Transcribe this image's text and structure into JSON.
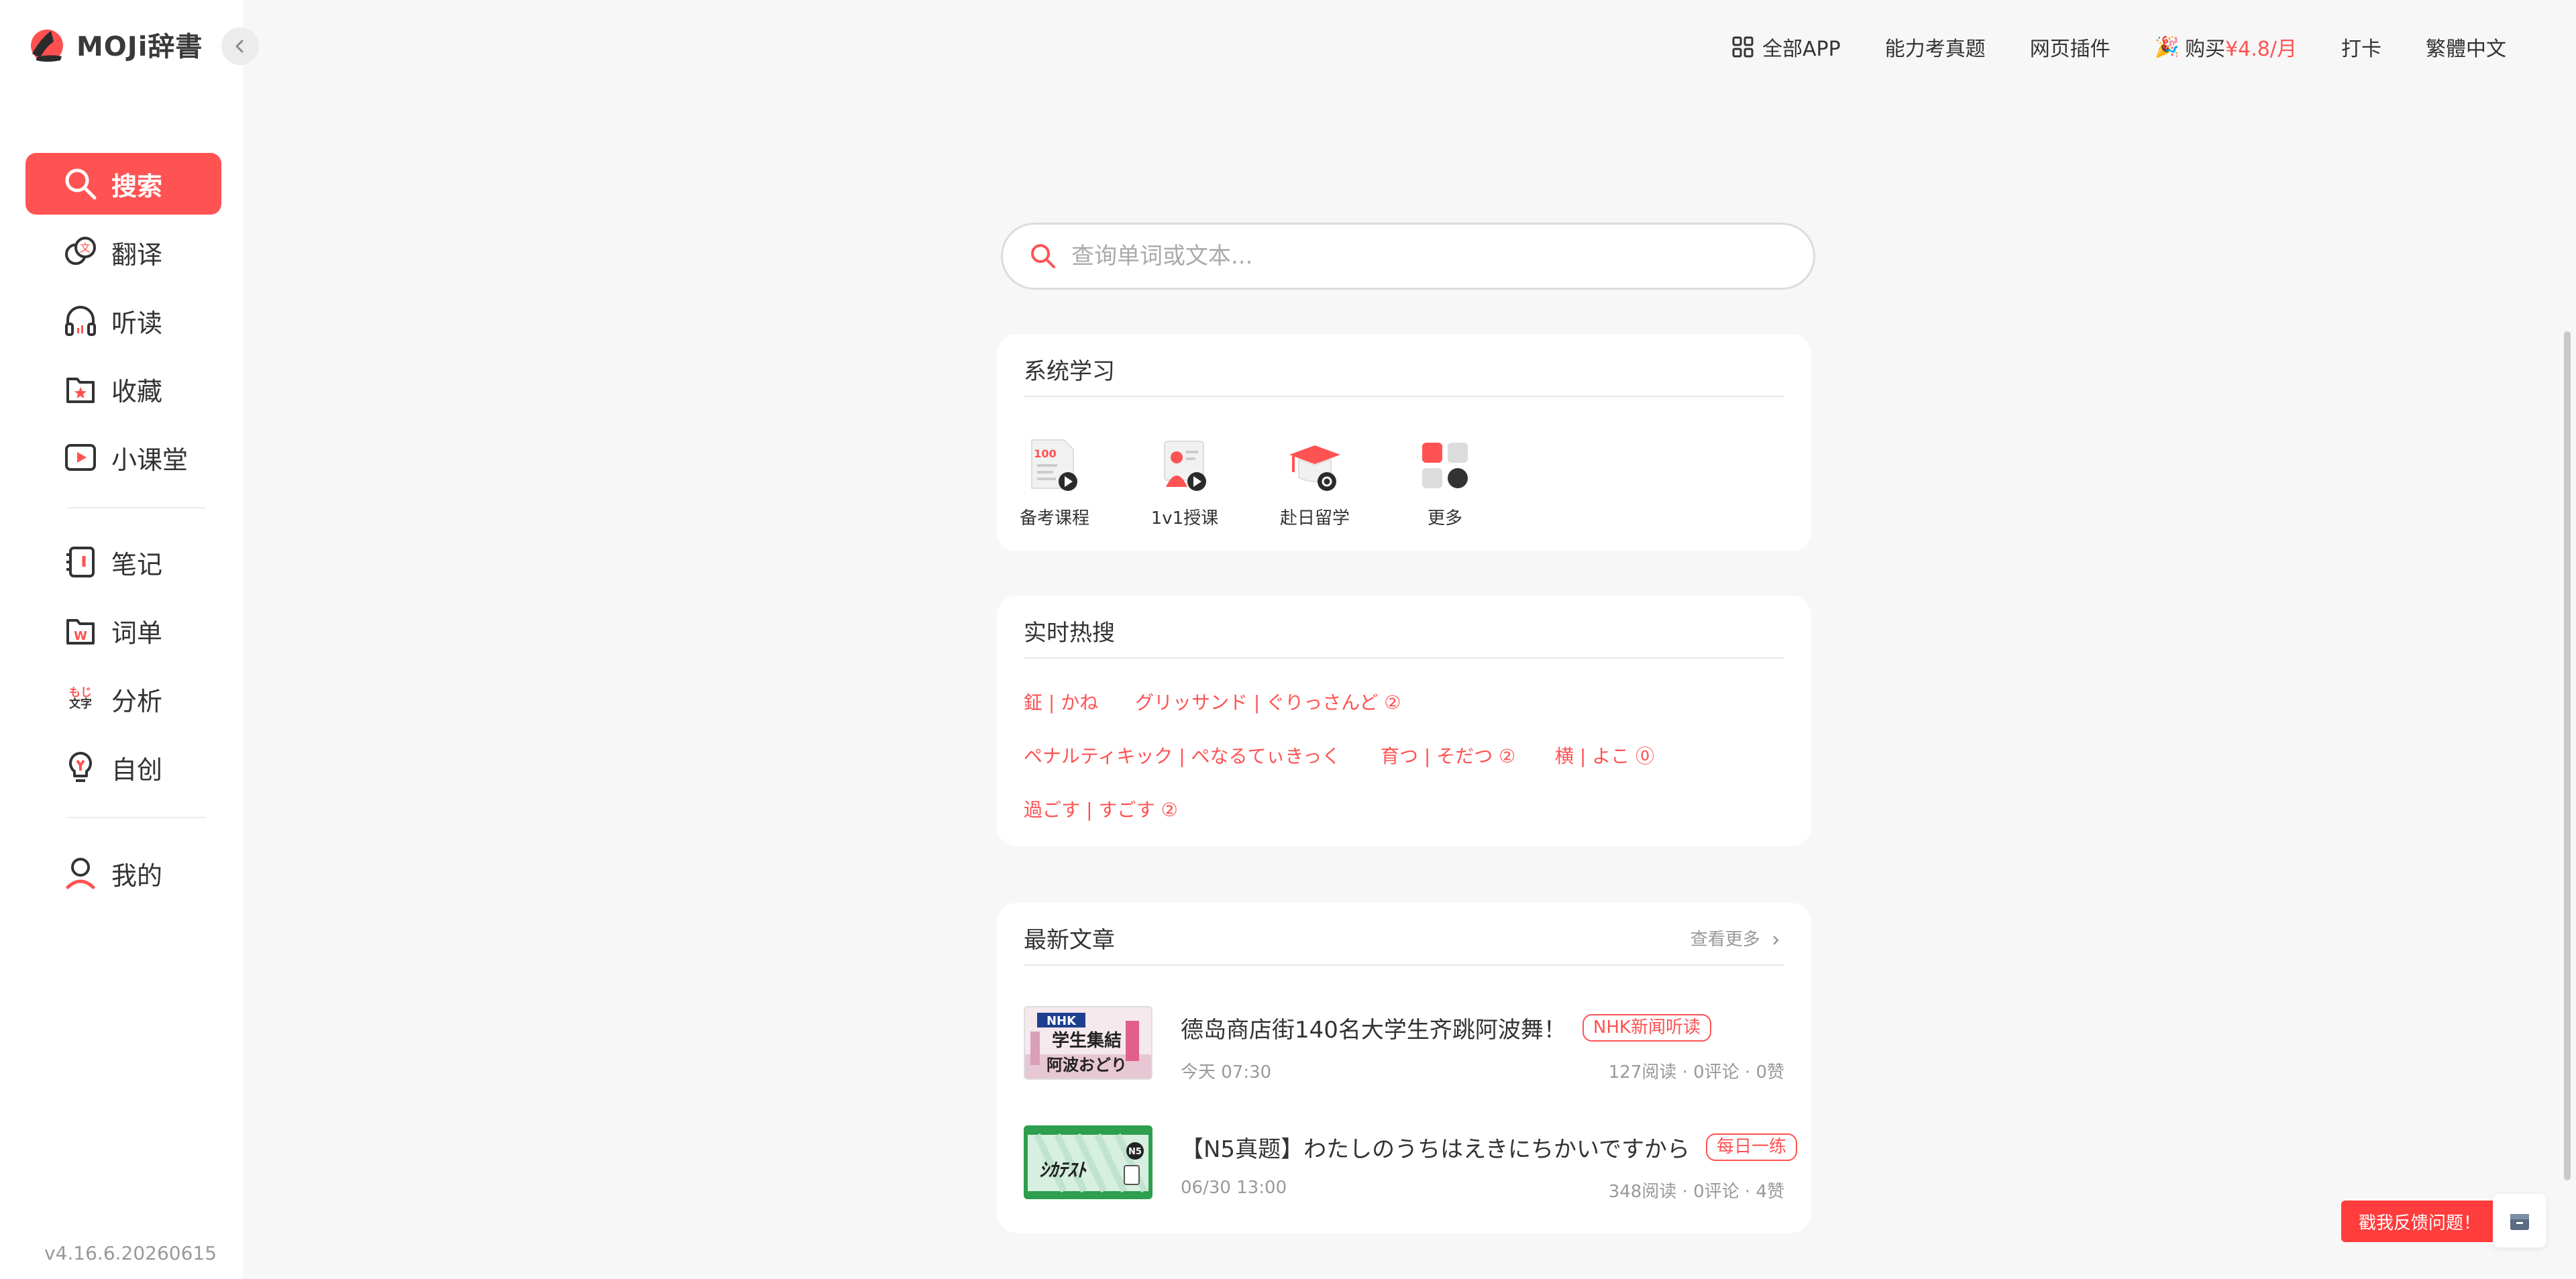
{
  "app": {
    "name": "MOJi辞書",
    "version": "v4.16.6.20260615"
  },
  "sidebar": {
    "items": [
      {
        "label": "搜索",
        "icon": "search-icon",
        "active": true
      },
      {
        "label": "翻译",
        "icon": "translate-icon"
      },
      {
        "label": "听读",
        "icon": "headphones-icon"
      },
      {
        "label": "收藏",
        "icon": "favorites-icon"
      },
      {
        "label": "小课堂",
        "icon": "video-play-icon"
      },
      {
        "label": "笔记",
        "icon": "notebook-icon"
      },
      {
        "label": "词单",
        "icon": "word-list-icon"
      },
      {
        "label": "分析",
        "icon": "moji-analysis-icon",
        "icon_text": [
          "もじ",
          "文字"
        ]
      },
      {
        "label": "自创",
        "icon": "lightbulb-icon"
      },
      {
        "label": "我的",
        "icon": "user-icon"
      }
    ]
  },
  "topnav": {
    "all_apps": "全部APP",
    "exam": "能力考真题",
    "plugin": "网页插件",
    "buy_prefix": "购买",
    "buy_price": "¥4.8/月",
    "checkin": "打卡",
    "language": "繁體中文"
  },
  "search": {
    "placeholder": "查询单词或文本..."
  },
  "system_study": {
    "title": "系统学习",
    "items": [
      {
        "label": "备考课程",
        "icon": "course-icon",
        "icon_text": "100"
      },
      {
        "label": "1v1授课",
        "icon": "tutor-icon"
      },
      {
        "label": "赴日留学",
        "icon": "study-abroad-icon"
      },
      {
        "label": "更多",
        "icon": "more-apps-icon"
      }
    ]
  },
  "hot_search": {
    "title": "实时热搜",
    "words": [
      "鉦 | かね",
      "グリッサンド | ぐりっさんど ②",
      "ペナルティキック | ぺなるてぃきっく",
      "育つ | そだつ ②",
      "横 | よこ ⓪",
      "過ごす | すごす ②"
    ]
  },
  "articles": {
    "title": "最新文章",
    "more": "查看更多",
    "items": [
      {
        "title": "德岛商店街140名大学生齐跳阿波舞！",
        "tag": "NHK新闻听读",
        "time": "今天 07:30",
        "stats": "127阅读 · 0评论 · 0赞",
        "thumb_text": [
          "NHK",
          "学生集結",
          "阿波おどり"
        ]
      },
      {
        "title": "【N5真题】わたしのうちはえきにちかいですから",
        "tag": "每日一练",
        "time": "06/30 13:00",
        "stats": "348阅读 · 0评论 · 4赞",
        "thumb_text": [
          "N5",
          "ｼｶﾃｽﾄ"
        ]
      }
    ]
  },
  "feedback": {
    "label": "戳我反馈问题！"
  },
  "colors": {
    "accent": "#ff5252",
    "sidebar_bg": "#ffffff",
    "page_bg": "#f7f7f7"
  }
}
